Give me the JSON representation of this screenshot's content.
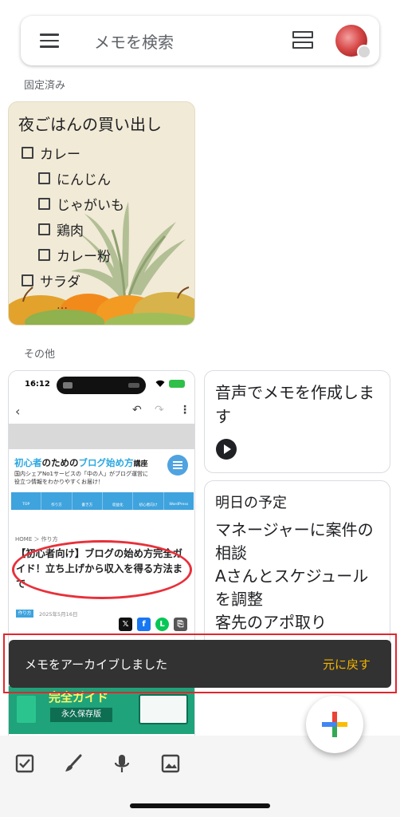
{
  "search": {
    "placeholder_text": "メモを検索"
  },
  "sections": {
    "pinned": "固定済み",
    "others": "その他"
  },
  "pinned_note": {
    "title": "夜ごはんの買い出し",
    "items": [
      {
        "label": "カレー",
        "indent": 0
      },
      {
        "label": "にんじん",
        "indent": 1
      },
      {
        "label": "じゃがいも",
        "indent": 1
      },
      {
        "label": "鶏肉",
        "indent": 1
      },
      {
        "label": "カレー粉",
        "indent": 1
      },
      {
        "label": "サラダ",
        "indent": 0
      }
    ],
    "more": "…",
    "background_color": "#f1ead6"
  },
  "screenshot_note": {
    "status_time": "16:12",
    "site_title_highlight": "初心者",
    "site_title_mid": "のための",
    "site_title_blue": "ブログ始め方",
    "site_title_end": "講座",
    "site_sub_line1": "国内シェアNo1サービスの「中の人」がブログ運営に",
    "site_sub_line2": "役立つ情報をわかりやすくお届け！",
    "nav_items": [
      "TOP",
      "作り方",
      "書き方",
      "収益化",
      "初心者向け",
      "WordPress"
    ],
    "breadcrumb": "HOME ＞ 作り方",
    "article_title": "【初心者向け】ブログの始め方完全ガイド！立ち上げから収入を得る方法まで",
    "tag": "作り方",
    "date": "2025年5月16日",
    "promo_title": "完全ガイド",
    "promo_tag": "永久保存版"
  },
  "voice_note": {
    "text": "音声でメモを作成します"
  },
  "plan_note": {
    "title": "明日の予定",
    "body": "マネージャーに案件の相談\nAさんとスケジュールを調整\n客先のアポ取り"
  },
  "snackbar": {
    "message": "メモをアーカイブしました",
    "action": "元に戻す",
    "action_color": "#f4b400",
    "outline_color": "#e3262e"
  },
  "fab": {
    "icon": "plus-icon"
  },
  "bottom_bar": {
    "icons": [
      "checkbox-icon",
      "brush-icon",
      "mic-icon",
      "image-icon"
    ]
  }
}
